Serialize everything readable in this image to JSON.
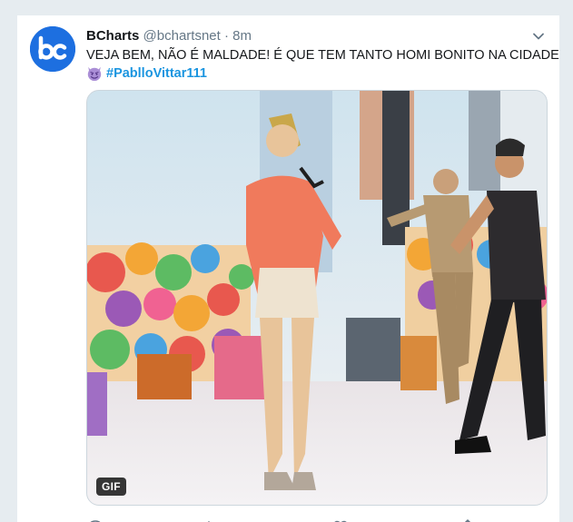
{
  "tweet": {
    "display_name": "BCharts",
    "handle": "@bchartsnet",
    "separator": "·",
    "time": "8m",
    "text": "VEJA BEM, NÃO É MALDADE! É QUE TEM TANTO HOMI BONITO NA CIDADE",
    "hashtag": "#PablloVittar111",
    "media_badge": "GIF"
  },
  "icons": {
    "avatar": "bcharts-logo",
    "caret": "chevron-down-icon",
    "emoji": "smiling-devil-emoji",
    "reply": "reply-icon",
    "retweet": "retweet-icon",
    "like": "heart-icon",
    "share": "share-icon"
  },
  "colors": {
    "brand_blue": "#1d6fe0",
    "link_blue": "#1b95e0",
    "muted_text": "#657786",
    "emoji_purple": "#aa8ed6"
  }
}
